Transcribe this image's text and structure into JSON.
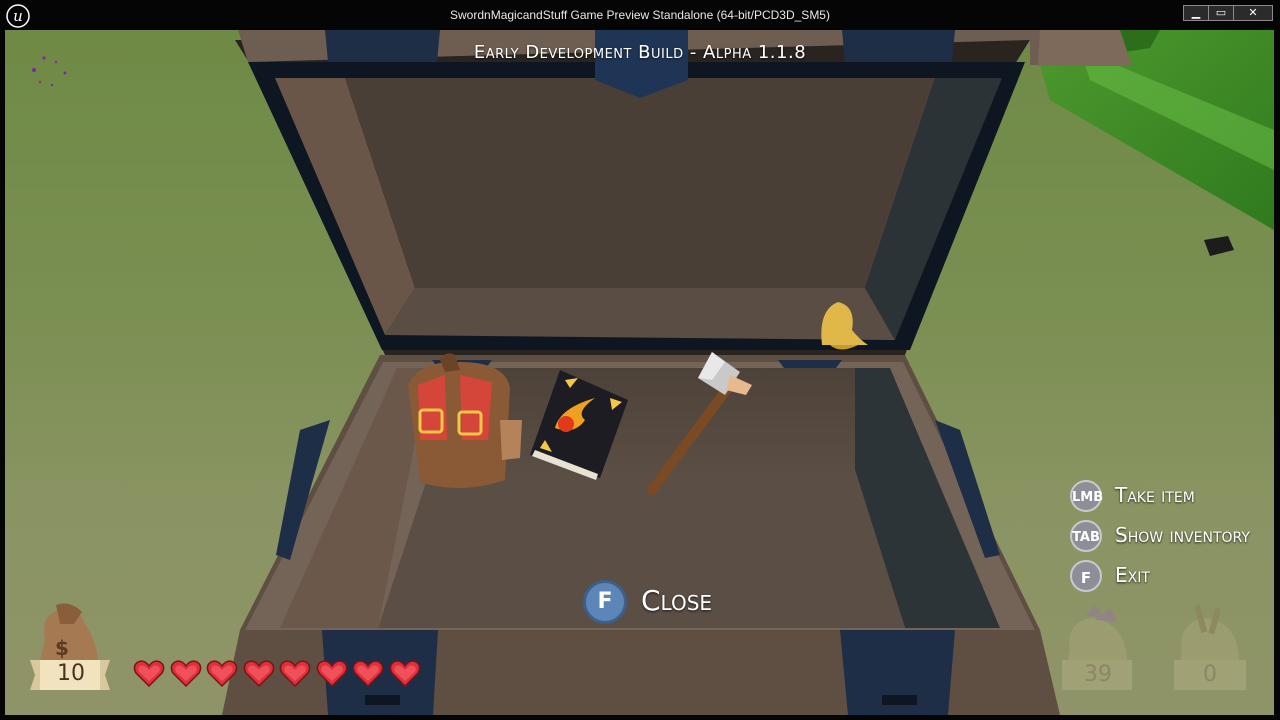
{
  "window": {
    "title": "SwordnMagicandStuff Game Preview Standalone (64-bit/PCD3D_SM5)",
    "buttons": {
      "minimize": "▁",
      "maximize": "▭",
      "close": "✕"
    }
  },
  "hud": {
    "build_label": "Early Development Build - Alpha 1.1.8",
    "hints": [
      {
        "key": "LMB",
        "label": "Take item"
      },
      {
        "key": "TAB",
        "label": "Show inventory"
      },
      {
        "key": "F",
        "label": "Exit"
      }
    ],
    "close_prompt": {
      "key": "F",
      "label": "Close"
    },
    "money": 10,
    "hearts": {
      "current": 8,
      "max": 8
    },
    "resources": [
      {
        "name": "crystal-bag",
        "value": 39
      },
      {
        "name": "wood-bag",
        "value": 0
      }
    ]
  },
  "chest_items": [
    "backpack-icon",
    "fire-spellbook-icon",
    "axe-icon",
    "bell-icon"
  ],
  "colors": {
    "grass": "#6f8a45",
    "chest_wood": "#5e4f42",
    "chest_trim": "#1c2a3f",
    "heart": "#e0303a",
    "key_blue": "#5c86b8"
  }
}
